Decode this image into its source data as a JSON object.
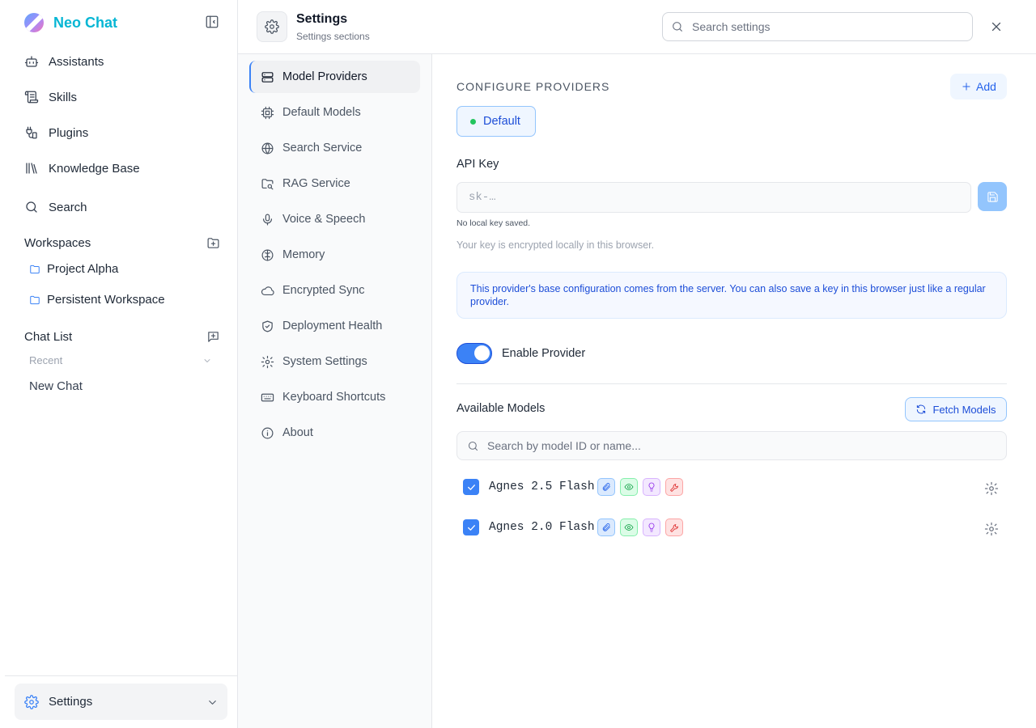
{
  "app": {
    "name": "Neo Chat"
  },
  "sidebar": {
    "nav": [
      {
        "label": "Assistants",
        "icon": "bot-icon"
      },
      {
        "label": "Skills",
        "icon": "scroll-icon"
      },
      {
        "label": "Plugins",
        "icon": "plug-icon"
      },
      {
        "label": "Knowledge Base",
        "icon": "library-icon"
      },
      {
        "label": "Search",
        "icon": "search-icon"
      }
    ],
    "workspaces_label": "Workspaces",
    "workspaces": [
      "Project Alpha",
      "Persistent Workspace"
    ],
    "chatlist_label": "Chat List",
    "recent_label": "Recent",
    "chats": [
      "New Chat"
    ],
    "settings_label": "Settings"
  },
  "header": {
    "title": "Settings",
    "subtitle": "Settings sections",
    "search_placeholder": "Search settings"
  },
  "settings_nav": [
    {
      "label": "Model Providers",
      "icon": "server-icon",
      "active": true
    },
    {
      "label": "Default Models",
      "icon": "cpu-icon"
    },
    {
      "label": "Search Service",
      "icon": "globe-icon"
    },
    {
      "label": "RAG Service",
      "icon": "folder-search-icon"
    },
    {
      "label": "Voice & Speech",
      "icon": "mic-icon"
    },
    {
      "label": "Memory",
      "icon": "brain-icon"
    },
    {
      "label": "Encrypted Sync",
      "icon": "cloud-icon"
    },
    {
      "label": "Deployment Health",
      "icon": "shield-check-icon"
    },
    {
      "label": "System Settings",
      "icon": "gear-icon"
    },
    {
      "label": "Keyboard Shortcuts",
      "icon": "keyboard-icon"
    },
    {
      "label": "About",
      "icon": "info-icon"
    }
  ],
  "content": {
    "configure_label": "CONFIGURE PROVIDERS",
    "add_label": "Add",
    "provider_tab": "Default",
    "api_key_label": "API Key",
    "api_key_placeholder": "sk-…",
    "no_key_note": "No local key saved.",
    "encryption_note": "Your key is encrypted locally in this browser.",
    "info_text": "This provider's base configuration comes from the server. You can also save a key in this browser just like a regular provider.",
    "enable_label": "Enable Provider",
    "enabled": true,
    "available_models_label": "Available Models",
    "fetch_label": "Fetch Models",
    "model_search_placeholder": "Search by model ID or name...",
    "models": [
      {
        "name": "Agnes 2.5 Flash",
        "checked": true
      },
      {
        "name": "Agnes 2.0 Flash",
        "checked": true
      }
    ]
  },
  "colors": {
    "accent": "#3b82f6",
    "brand": "#06b6d4"
  }
}
